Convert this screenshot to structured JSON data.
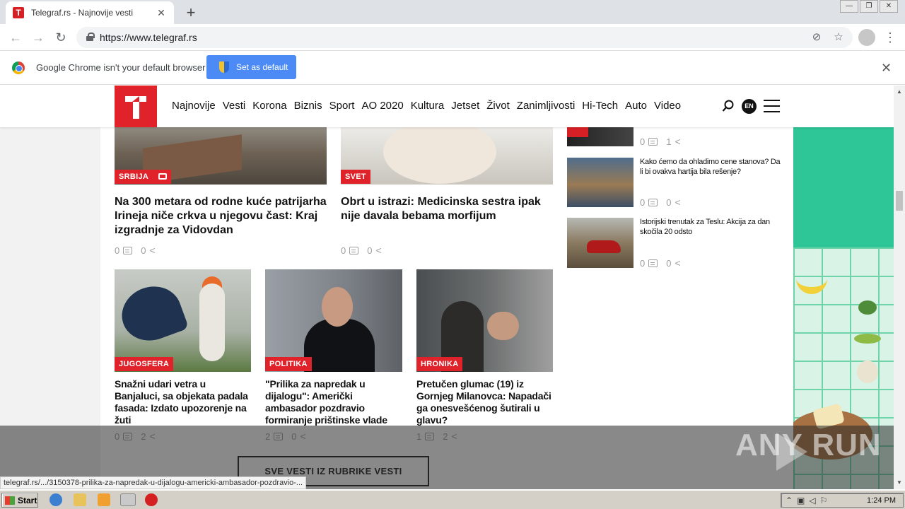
{
  "browser": {
    "tab_title": "Telegraf.rs - Najnovije vesti",
    "tab_favicon": "T",
    "new_tab_symbol": "+",
    "url": "https://www.telegraf.rs",
    "window_buttons": [
      "—",
      "❐",
      "✕"
    ]
  },
  "infobar": {
    "message": "Google Chrome isn't your default browser",
    "set_default_label": "Set as default"
  },
  "site": {
    "nav": [
      "Najnovije",
      "Vesti",
      "Korona",
      "Biznis",
      "Sport",
      "AO 2020",
      "Kultura",
      "Jetset",
      "Život",
      "Zanimljivosti",
      "Hi-Tech",
      "Auto",
      "Video"
    ],
    "lang": "EN"
  },
  "articles_top": [
    {
      "category": "SRBIJA",
      "title": "Na 300 metara od rodne kuće patrijarha Irineja niče crkva u njegovu čast: Kraj izgradnje za Vidovdan",
      "comments": "0",
      "shares": "0"
    },
    {
      "category": "SVET",
      "title": "Obrt u istrazi: Medicinska sestra ipak nije davala bebama morfijum",
      "comments": "0",
      "shares": "0"
    }
  ],
  "articles_grid": [
    {
      "category": "JUGOSFERA",
      "title": "Snažni udari vetra u Banjaluci, sa objekata padala fasada: Izdato upozorenje na žuti",
      "comments": "0",
      "shares": "2"
    },
    {
      "category": "POLITIKA",
      "title": "\"Prilika za napredak u dijalogu\": Američki ambasador pozdravio formiranje prištinske vlade",
      "comments": "2",
      "shares": "0"
    },
    {
      "category": "HRONIKA",
      "title": "Pretučen glumac (19) iz Gornjeg Milanovca: Napadači ga onesvešćenog šutirali u glavu?",
      "comments": "1",
      "shares": "2"
    }
  ],
  "sidebar": [
    {
      "title": "",
      "comments": "0",
      "shares": "1"
    },
    {
      "title": "Kako ćemo da ohladimo cene stanova? Da li bi ovakva hartija bila rešenje?",
      "comments": "0",
      "shares": "0"
    },
    {
      "title": "Istorijski trenutak za Teslu: Akcija za dan skočila 20 odsto",
      "comments": "0",
      "shares": "0"
    }
  ],
  "more_button": "SVE VESTI IZ RUBRIKE VESTI",
  "status_url": "telegraf.rs/.../3150378-prilika-za-napredak-u-dijalogu-americki-ambasador-pozdravio-...",
  "watermark": "ANY RUN",
  "taskbar": {
    "start": "Start",
    "clock": "1:24 PM"
  },
  "colors": {
    "brand_red": "#e0232a",
    "chrome_blue": "#4c8bf5"
  }
}
